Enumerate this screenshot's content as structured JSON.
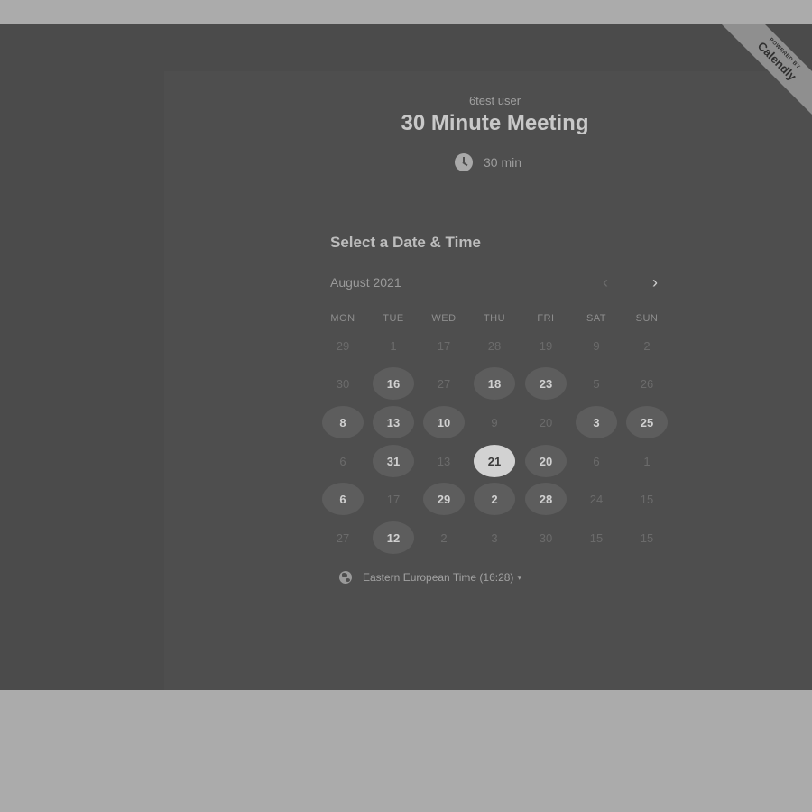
{
  "event": {
    "owner": "6test user",
    "title": "30 Minute Meeting",
    "duration": "30 min",
    "duration_icon": "clock-icon"
  },
  "ribbon": {
    "top": "POWERED BY",
    "brand": "Calendly"
  },
  "calendar": {
    "heading": "Select a Date & Time",
    "month": "August 2021",
    "prev_label": "‹",
    "next_label": "›",
    "weekdays": [
      "MON",
      "TUE",
      "WED",
      "THU",
      "FRI",
      "SAT",
      "SUN"
    ],
    "weeks": [
      [
        {
          "v": "29"
        },
        {
          "v": "1"
        },
        {
          "v": "17"
        },
        {
          "v": "28"
        },
        {
          "v": "19"
        },
        {
          "v": "9"
        },
        {
          "v": "2"
        }
      ],
      [
        {
          "v": "30"
        },
        {
          "v": "16",
          "s": "avail"
        },
        {
          "v": "27"
        },
        {
          "v": "18",
          "s": "avail"
        },
        {
          "v": "23",
          "s": "avail"
        },
        {
          "v": "5"
        },
        {
          "v": "26"
        }
      ],
      [
        {
          "v": "8",
          "s": "avail"
        },
        {
          "v": "13",
          "s": "avail"
        },
        {
          "v": "10",
          "s": "avail"
        },
        {
          "v": "9"
        },
        {
          "v": "20"
        },
        {
          "v": "3",
          "s": "avail"
        },
        {
          "v": "25",
          "s": "avail"
        }
      ],
      [
        {
          "v": "6"
        },
        {
          "v": "31",
          "s": "avail"
        },
        {
          "v": "13"
        },
        {
          "v": "21",
          "s": "selected"
        },
        {
          "v": "20",
          "s": "avail"
        },
        {
          "v": "6"
        },
        {
          "v": "1"
        }
      ],
      [
        {
          "v": "6",
          "s": "avail"
        },
        {
          "v": "17"
        },
        {
          "v": "29",
          "s": "avail"
        },
        {
          "v": "2",
          "s": "avail"
        },
        {
          "v": "28",
          "s": "avail"
        },
        {
          "v": "24"
        },
        {
          "v": "15"
        }
      ],
      [
        {
          "v": "27"
        },
        {
          "v": "12",
          "s": "avail"
        },
        {
          "v": "2"
        },
        {
          "v": "3"
        },
        {
          "v": "30"
        },
        {
          "v": "15"
        },
        {
          "v": "15"
        }
      ]
    ]
  },
  "timezone": {
    "label": "Eastern European Time (16:28)",
    "icon": "globe-icon",
    "caret": "▾"
  }
}
